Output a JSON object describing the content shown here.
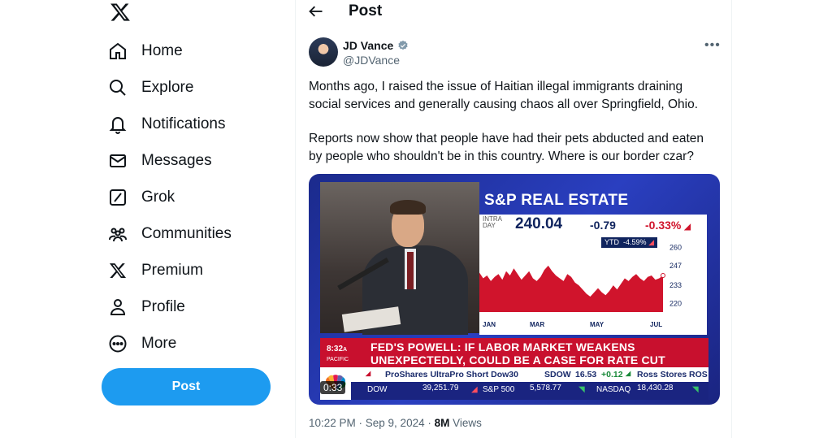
{
  "nav": {
    "items": [
      {
        "label": "Home",
        "icon": "home-icon"
      },
      {
        "label": "Explore",
        "icon": "search-icon"
      },
      {
        "label": "Notifications",
        "icon": "bell-icon"
      },
      {
        "label": "Messages",
        "icon": "envelope-icon"
      },
      {
        "label": "Grok",
        "icon": "grok-icon"
      },
      {
        "label": "Communities",
        "icon": "people-icon"
      },
      {
        "label": "Premium",
        "icon": "x-logo-icon"
      },
      {
        "label": "Profile",
        "icon": "person-icon"
      },
      {
        "label": "More",
        "icon": "more-circle-icon"
      }
    ],
    "post_label": "Post"
  },
  "header": {
    "title": "Post"
  },
  "tweet": {
    "author": "JD Vance",
    "handle": "@JDVance",
    "paragraphs": [
      "Months ago, I raised the issue of Haitian illegal immigrants draining social services and generally causing chaos all over Springfield, Ohio.",
      "Reports now show that people have had their pets abducted and eaten by people who shouldn't be in this country. Where is our border czar?"
    ],
    "timestamp": "10:22 PM · Sep 9, 2024 ·",
    "views_count": "8M",
    "views_label": "Views"
  },
  "media": {
    "chart_title": "S&P REAL ESTATE",
    "intraday_label_1": "INTRA",
    "intraday_label_2": "DAY",
    "price": "240.04",
    "change": "-0.79",
    "pct_change": "-0.33%",
    "ytd_label": "YTD",
    "ytd_value": "-4.59%",
    "lower_third_time": "8:32",
    "lower_third_ampm": "A",
    "lower_third_tz": "PACIFIC",
    "headline_line1": "FED'S POWELL: IF LABOR MARKET WEAKENS",
    "headline_line2": "UNEXPECTEDLY, COULD BE A CASE FOR RATE CUT",
    "ticker1": [
      "ProShares UltraPro Short Dow30",
      "SDOW",
      "16.53",
      "+0.12",
      "Ross Stores",
      "ROS"
    ],
    "ticker2": [
      {
        "name": "DOW",
        "value": "39,251.79"
      },
      {
        "name": "S&P 500",
        "value": "5,578.77"
      },
      {
        "name": "NASDAQ",
        "value": "18,430.28"
      }
    ],
    "duration": "0:33",
    "colors": {
      "red": "#d0142c",
      "navy": "#10245e",
      "blue": "#1d9bf0"
    }
  },
  "chart_data": {
    "type": "area",
    "x": [
      "JAN",
      "MAR",
      "MAY",
      "JUL"
    ],
    "ylim": [
      214,
      266
    ],
    "yticks": [
      260,
      247,
      233,
      220
    ],
    "values": [
      242,
      238,
      240,
      236,
      239,
      241,
      237,
      243,
      240,
      245,
      241,
      237,
      240,
      243,
      238,
      236,
      239,
      244,
      247,
      243,
      240,
      238,
      236,
      241,
      239,
      235,
      233,
      230,
      227,
      225,
      228,
      231,
      228,
      226,
      229,
      233,
      230,
      234,
      238,
      236,
      239,
      241,
      238,
      236,
      239,
      240,
      237,
      238,
      240
    ]
  }
}
